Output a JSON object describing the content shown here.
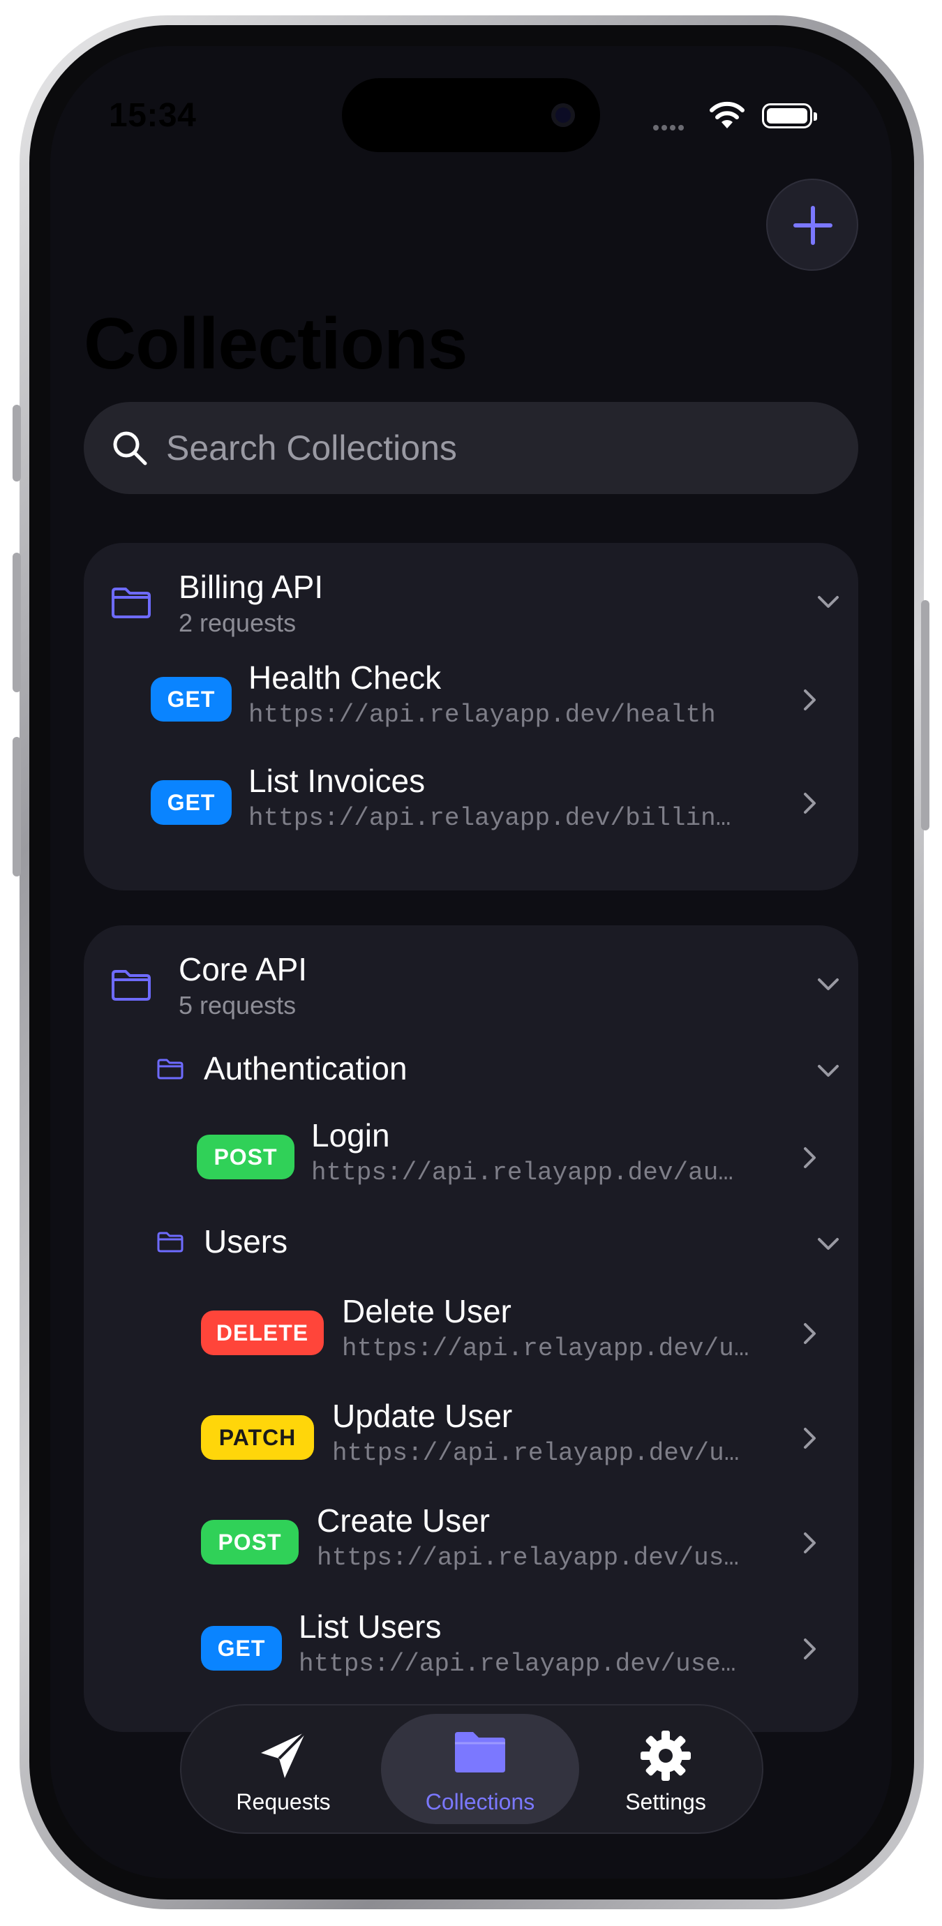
{
  "status_bar": {
    "time": "15:34"
  },
  "header": {
    "title": "Collections",
    "add_icon": "plus-icon"
  },
  "search": {
    "placeholder": "Search Collections"
  },
  "collections": [
    {
      "name": "Billing API",
      "count": "2 requests",
      "requests": [
        {
          "method": "GET",
          "name": "Health Check",
          "url": "https://api.relayapp.dev/health"
        },
        {
          "method": "GET",
          "name": "List Invoices",
          "url": "https://api.relayapp.dev/billin…"
        }
      ]
    },
    {
      "name": "Core API",
      "count": "5 requests",
      "folders": [
        {
          "name": "Authentication",
          "requests": [
            {
              "method": "POST",
              "name": "Login",
              "url": "https://api.relayapp.dev/au…"
            }
          ]
        },
        {
          "name": "Users",
          "requests": [
            {
              "method": "DELETE",
              "name": "Delete User",
              "url": "https://api.relayapp.dev/u…"
            },
            {
              "method": "PATCH",
              "name": "Update User",
              "url": "https://api.relayapp.dev/u…"
            },
            {
              "method": "POST",
              "name": "Create User",
              "url": "https://api.relayapp.dev/us…"
            },
            {
              "method": "GET",
              "name": "List Users",
              "url": "https://api.relayapp.dev/use…"
            }
          ]
        }
      ]
    }
  ],
  "tab_bar": {
    "tabs": [
      {
        "label": "Requests",
        "icon": "paper-plane-icon"
      },
      {
        "label": "Collections",
        "icon": "folder-icon",
        "active": true
      },
      {
        "label": "Settings",
        "icon": "gear-icon"
      }
    ]
  },
  "colors": {
    "accent": "#7b78ff",
    "get": "#0a84ff",
    "post": "#30d158",
    "delete": "#ff453a",
    "patch": "#ffd60a"
  }
}
